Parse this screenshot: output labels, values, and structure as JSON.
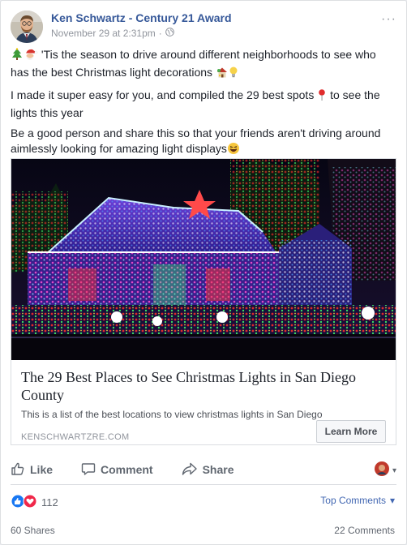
{
  "post": {
    "author": "Ken Schwartz - Century 21 Award",
    "timestamp": "November 29 at 2:31pm",
    "separator": "·",
    "options": "···",
    "lines": [
      "'Tis the season to drive around different neighborhoods to see who has the best Christmas light decorations",
      "I made it super easy for you, and compiled the 29 best spots",
      "to see the lights this year",
      "Be a good person and share this so that your friends aren't driving around aimlessly looking for amazing light displays"
    ]
  },
  "link": {
    "title": "The 29 Best Places to See Christmas Lights in San Diego County",
    "description": "This is a list of the best locations to view christmas lights in San Diego",
    "domain": "KENSCHWARTZRE.COM",
    "button": "Learn More"
  },
  "actions": {
    "like": "Like",
    "comment": "Comment",
    "share": "Share",
    "sharer_caret": "▾"
  },
  "footer": {
    "reaction_count": "112",
    "sort_label": "Top Comments",
    "sort_caret": "▾",
    "shares": "60 Shares",
    "comments": "22 Comments"
  },
  "colors": {
    "brand_blue": "#365899",
    "link_blue": "#4267b2",
    "like_blue": "#1877f2",
    "love_red": "#f0284a",
    "muted": "#90949c"
  },
  "icons": [
    "avatar",
    "globe-icon",
    "tree-emoji",
    "santa-emoji",
    "house-emoji",
    "lightbulb-emoji",
    "pin-emoji",
    "laugh-emoji",
    "like-icon",
    "comment-icon",
    "share-icon",
    "love-icon"
  ]
}
